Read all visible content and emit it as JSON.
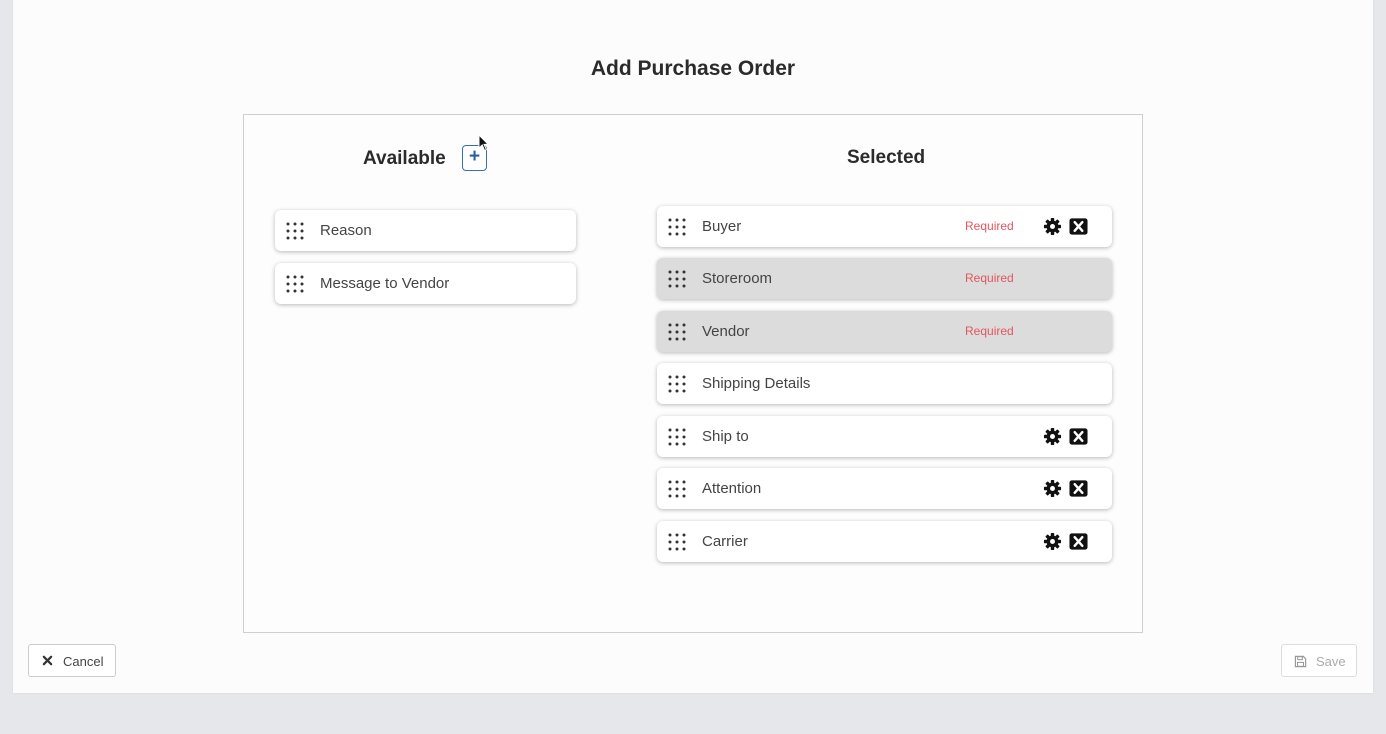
{
  "page": {
    "title": "Add Purchase Order"
  },
  "available": {
    "title": "Available",
    "add_icon": "plus-icon",
    "items": [
      {
        "label": "Reason"
      },
      {
        "label": "Message to Vendor"
      }
    ]
  },
  "selected": {
    "title": "Selected",
    "items": [
      {
        "label": "Buyer",
        "required": "Required",
        "gear": true,
        "remove": true
      },
      {
        "label": "Storeroom",
        "required": "Required",
        "gear": false,
        "remove": false
      },
      {
        "label": "Vendor",
        "required": "Required",
        "gear": false,
        "remove": false
      },
      {
        "label": "Shipping Details",
        "required": "",
        "gear": false,
        "remove": false
      },
      {
        "label": "Ship to",
        "required": "",
        "gear": true,
        "remove": true
      },
      {
        "label": "Attention",
        "required": "",
        "gear": true,
        "remove": true
      },
      {
        "label": "Carrier",
        "required": "",
        "gear": true,
        "remove": true
      }
    ]
  },
  "footer": {
    "cancel_label": "Cancel",
    "save_label": "Save"
  },
  "colors": {
    "accent": "#2c5da8",
    "required": "#e4555f"
  }
}
